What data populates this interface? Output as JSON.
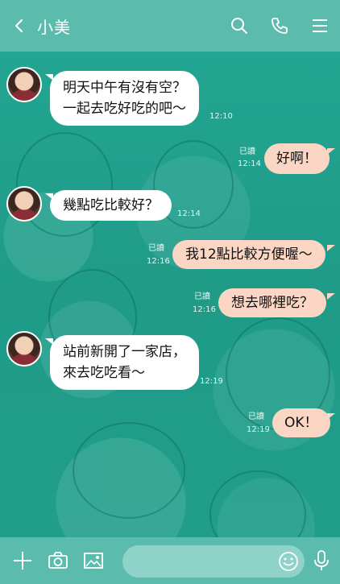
{
  "header": {
    "title": "小美"
  },
  "messages": [
    {
      "side": "in",
      "lines": [
        "明天中午有沒有空？",
        "一起去吃好吃的吧～"
      ],
      "time": "12:10"
    },
    {
      "side": "out",
      "lines": [
        "好啊！"
      ],
      "read": "已讀",
      "time": "12:14"
    },
    {
      "side": "in",
      "lines": [
        "幾點吃比較好？"
      ],
      "time": "12:14"
    },
    {
      "side": "out",
      "lines": [
        "我12點比較方便喔～"
      ],
      "read": "已讀",
      "time": "12:16"
    },
    {
      "side": "out",
      "lines": [
        "想去哪裡吃？"
      ],
      "read": "已讀",
      "time": "12:16"
    },
    {
      "side": "in",
      "lines": [
        "站前新開了一家店，",
        "來去吃吃看～"
      ],
      "time": "12:19"
    },
    {
      "side": "out",
      "lines": [
        "OK！"
      ],
      "read": "已讀",
      "time": "12:19"
    }
  ],
  "composer": {
    "placeholder": ""
  },
  "colors": {
    "header": "#5bbcae",
    "chat_background": "#1f9e8a",
    "incoming_bubble": "#ffffff",
    "outgoing_bubble": "#fbd6c4"
  },
  "icons": {
    "back": "chevron-left-icon",
    "search": "search-icon",
    "call": "phone-icon",
    "menu": "hamburger-menu-icon",
    "add": "plus-icon",
    "camera": "camera-icon",
    "image": "image-icon",
    "emoji": "smiley-icon",
    "mic": "microphone-icon"
  }
}
